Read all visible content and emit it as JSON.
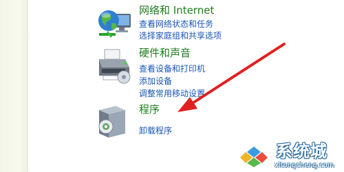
{
  "categories": [
    {
      "id": "network",
      "icon": "network-globe-icon",
      "title": "网络和 Internet",
      "links": [
        "查看网络状态和任务",
        "选择家庭组和共享选项"
      ]
    },
    {
      "id": "hardware",
      "icon": "printer-icon",
      "title": "硬件和声音",
      "links": [
        "查看设备和打印机",
        "添加设备",
        "调整常用移动设置"
      ]
    },
    {
      "id": "programs",
      "icon": "software-box-icon",
      "title": "程序",
      "links": [
        "卸载程序"
      ]
    }
  ],
  "annotation": {
    "icon": "red-arrow-icon",
    "color": "#e02020"
  },
  "watermark": {
    "brand": "系统城",
    "url": "xitongcheng.com",
    "logo": "windows-logo-icon"
  },
  "colors": {
    "title": "#1e7d1e",
    "link": "#1a55b5",
    "sidebar": "#f2f5e6"
  }
}
